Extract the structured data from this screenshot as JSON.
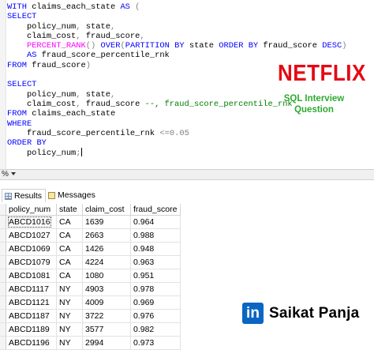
{
  "editor": {
    "lines": [
      "WITH claims_each_state AS (",
      "SELECT",
      "    policy_num, state,",
      "    claim_cost, fraud_score,",
      "    PERCENT_RANK() OVER(PARTITION BY state ORDER BY fraud_score DESC)",
      "    AS fraud_score_percentile_rnk",
      "FROM fraud_score)",
      "",
      "SELECT",
      "    policy_num, state,",
      "    claim_cost, fraud_score --, fraud_score_percentile_rnk",
      "FROM claims_each_state",
      "WHERE",
      "    fraud_score_percentile_rnk <=0.05",
      "ORDER BY",
      "    policy_num;"
    ]
  },
  "brand": {
    "logo": "NETFLIX",
    "subtitle_line1": "SQL Interview",
    "subtitle_line2": "Question",
    "logo_color": "#e50914",
    "subtitle_color": "#2eaa2e"
  },
  "statusbar": {
    "zoom": "%"
  },
  "tabs": {
    "results": "Results",
    "messages": "Messages"
  },
  "results": {
    "columns": [
      "policy_num",
      "state",
      "claim_cost",
      "fraud_score"
    ],
    "rows": [
      [
        "ABCD1016",
        "CA",
        "1639",
        "0.964"
      ],
      [
        "ABCD1027",
        "CA",
        "2663",
        "0.988"
      ],
      [
        "ABCD1069",
        "CA",
        "1426",
        "0.948"
      ],
      [
        "ABCD1079",
        "CA",
        "4224",
        "0.963"
      ],
      [
        "ABCD1081",
        "CA",
        "1080",
        "0.951"
      ],
      [
        "ABCD1117",
        "NY",
        "4903",
        "0.978"
      ],
      [
        "ABCD1121",
        "NY",
        "4009",
        "0.969"
      ],
      [
        "ABCD1187",
        "NY",
        "3722",
        "0.976"
      ],
      [
        "ABCD1189",
        "NY",
        "3577",
        "0.982"
      ],
      [
        "ABCD1196",
        "NY",
        "2994",
        "0.973"
      ]
    ]
  },
  "author": {
    "badge": "in",
    "name": "Saikat Panja",
    "badge_color": "#0a66c2"
  }
}
